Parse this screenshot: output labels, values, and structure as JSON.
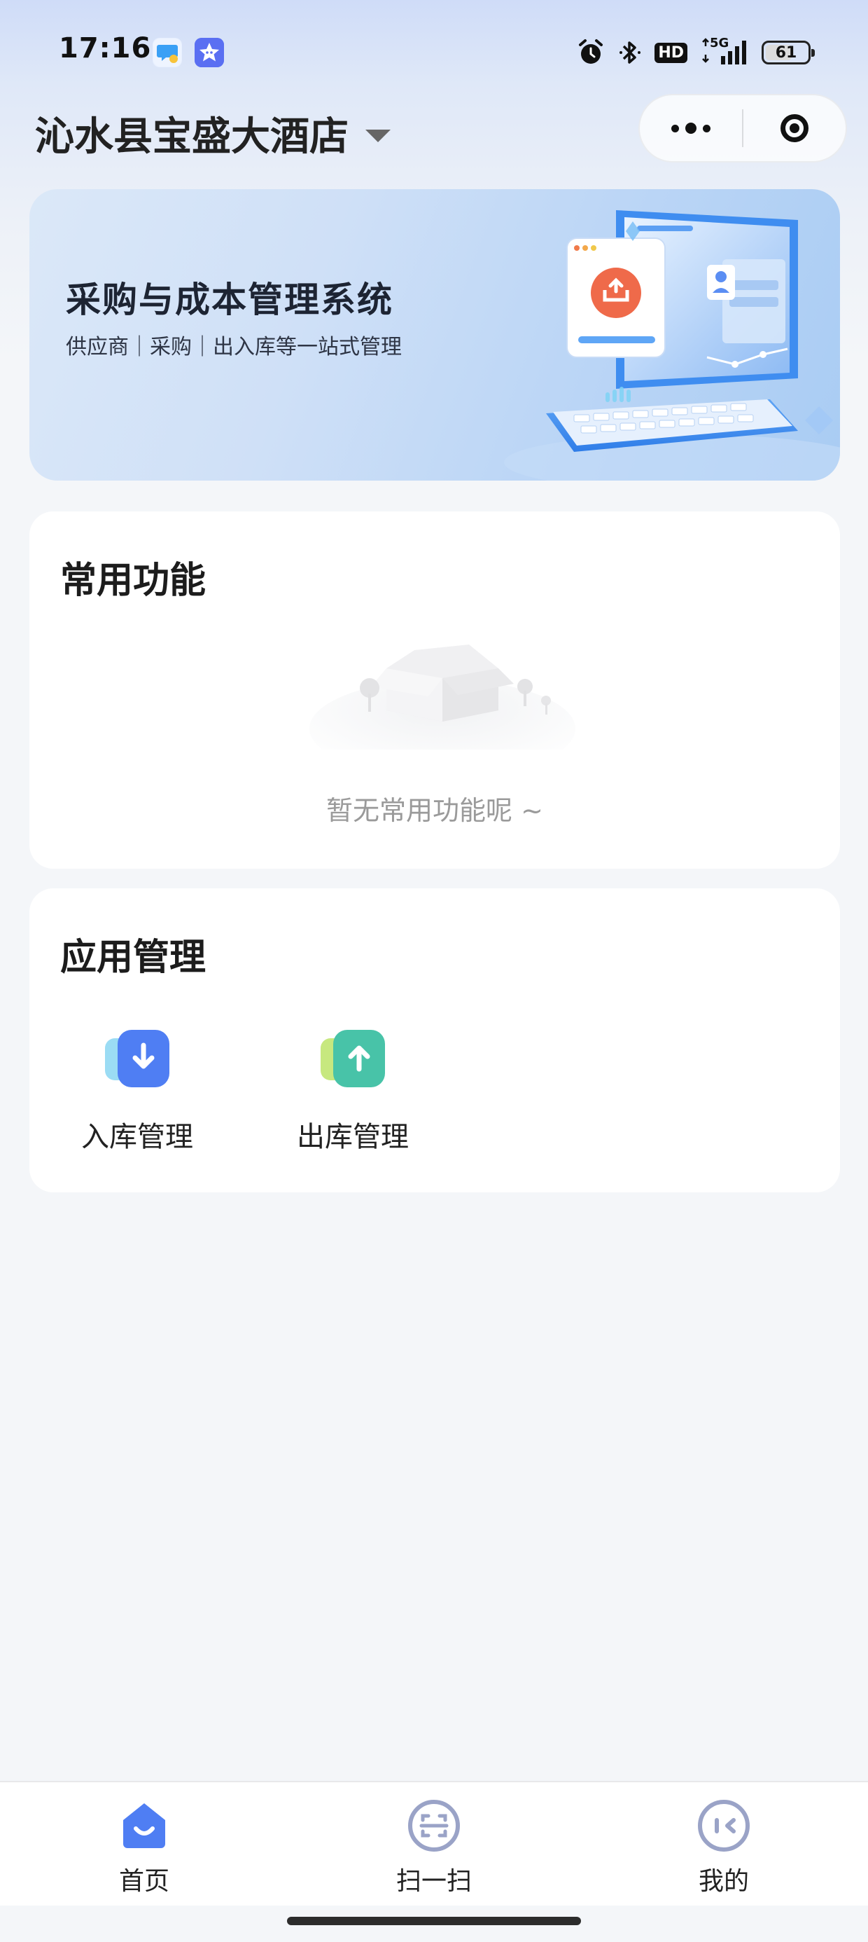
{
  "status_bar": {
    "time": "17:16",
    "network": "5G",
    "hd": "HD",
    "battery": "61"
  },
  "header": {
    "title": "沁水县宝盛大酒店",
    "icons": [
      "chevron-down-icon",
      "more-dots-icon",
      "close-target-icon"
    ]
  },
  "banner": {
    "title": "采购与成本管理系统",
    "subtitle": "供应商｜采购｜出入库等一站式管理"
  },
  "common_functions": {
    "title": "常用功能",
    "empty_text": "暂无常用功能呢 ~"
  },
  "app_management": {
    "title": "应用管理",
    "items": [
      {
        "label": "入库管理",
        "icon": "inbound-arrow-down-icon",
        "color": "#4f7ef3"
      },
      {
        "label": "出库管理",
        "icon": "outbound-arrow-up-icon",
        "color": "#48c3a8"
      }
    ]
  },
  "tabbar": {
    "items": [
      {
        "label": "首页",
        "icon": "home-icon",
        "active": true
      },
      {
        "label": "扫一扫",
        "icon": "scan-icon",
        "active": false
      },
      {
        "label": "我的",
        "icon": "profile-icon",
        "active": false
      }
    ]
  },
  "colors": {
    "accent": "#4f7ef3",
    "green": "#48c3a8",
    "tab_inactive": "#9aa3c7"
  }
}
